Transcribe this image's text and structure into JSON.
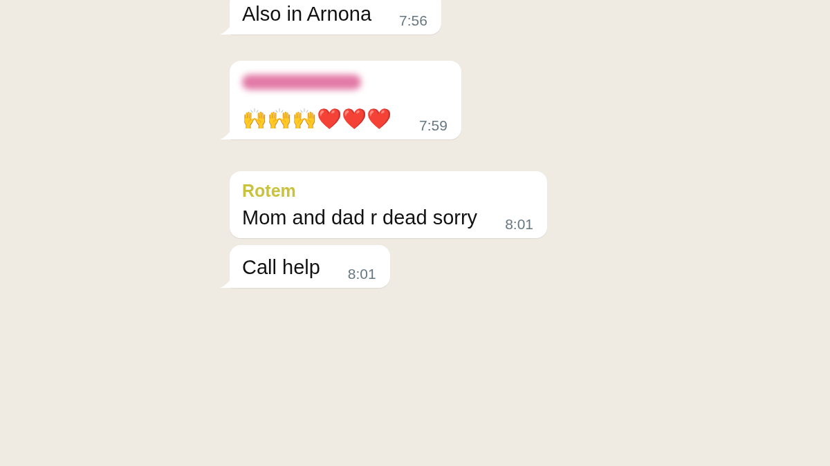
{
  "messages": [
    {
      "text": "Also in Arnona",
      "time": "7:56",
      "tail": true
    },
    {
      "sender": {
        "kind": "blurred",
        "color": "#e27aa6"
      },
      "text": "🙌🙌🙌❤️❤️❤️",
      "time": "7:59",
      "tail": true
    },
    {
      "sender": {
        "kind": "name",
        "name": "Rotem",
        "color": "#c9c23c"
      },
      "text": "Mom and dad r dead sorry",
      "time": "8:01",
      "tail": false
    },
    {
      "text": "Call help",
      "time": "8:01",
      "tail": true
    }
  ]
}
